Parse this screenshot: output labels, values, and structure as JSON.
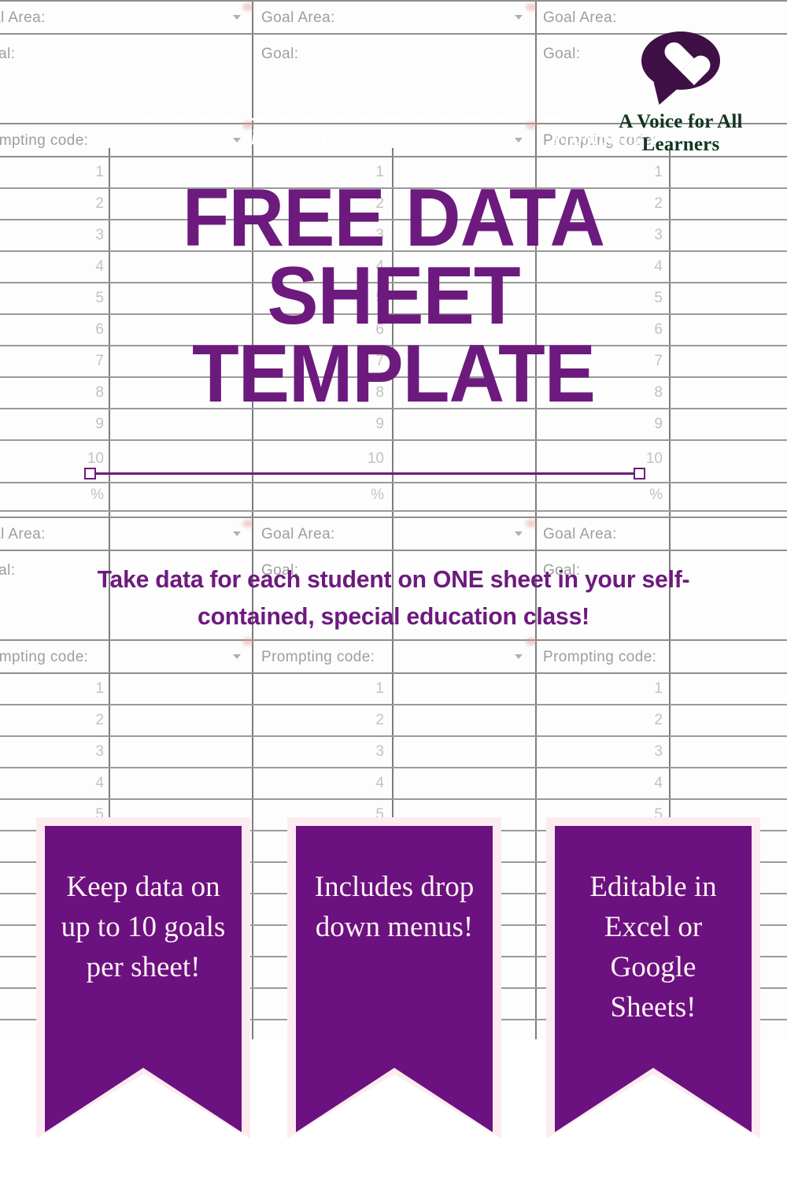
{
  "spreadsheet": {
    "goal_area_label": "Goal Area:",
    "goal_label": "Goal:",
    "prompting_code_label": "Prompting code:",
    "row_numbers": [
      "1",
      "2",
      "3",
      "4",
      "5",
      "6",
      "7",
      "8",
      "9",
      "10"
    ],
    "percent_row_label": "%",
    "lower_row_numbers": [
      "1",
      "2",
      "3",
      "4",
      "5"
    ],
    "watermark_text": "Prompting code:",
    "grid_line_color": "#8e8e8e",
    "label_color": "#9e9e9e"
  },
  "logo": {
    "icon": "speech-bubble-heart-icon",
    "line1": "A Voice for All",
    "line2": "Learners",
    "bubble_color": "#3f1046",
    "text_color": "#12361f"
  },
  "title": {
    "line1": "FREE DATA",
    "line2": "SHEET",
    "line3": "TEMPLATE",
    "color": "#6d1a7e"
  },
  "subtitle": {
    "text": "Take data for each student on ONE sheet in your self-contained, special education class!",
    "color": "#6d1a7e"
  },
  "banners": [
    {
      "text": "Keep data on up to 10 goals per sheet!"
    },
    {
      "text": "Includes drop down menus!"
    },
    {
      "text": "Editable in Excel or Google Sheets!"
    }
  ],
  "colors": {
    "brand_purple": "#6d1a7e",
    "banner_purple": "#6c1180",
    "banner_border_pink": "#fcecf0",
    "banner_text": "#fdf1f4"
  }
}
